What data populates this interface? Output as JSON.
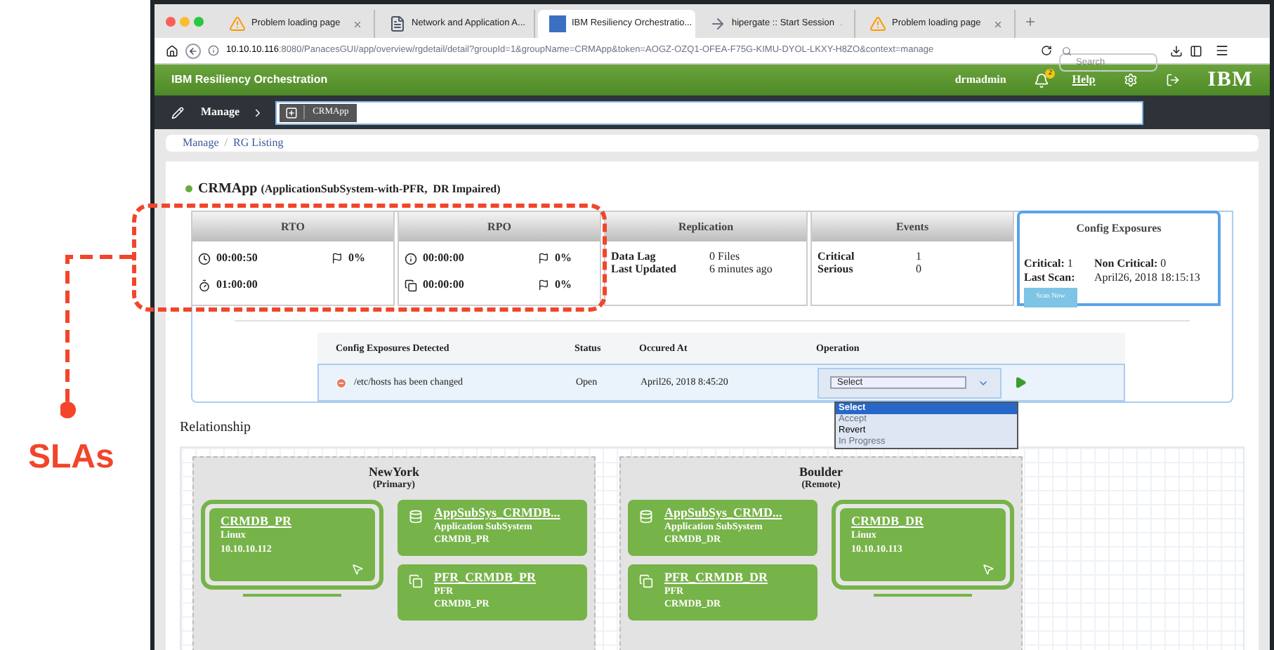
{
  "annotation": {
    "label": "SLAs"
  },
  "browser": {
    "tabs": [
      {
        "kind": "warning",
        "title": "Problem loading page",
        "selected": false
      },
      {
        "kind": "doc",
        "title": "Network and Application A...",
        "selected": false
      },
      {
        "kind": "app",
        "title": "IBM Resiliency Orchestratio...",
        "selected": true
      },
      {
        "kind": "arrow",
        "title": "hipergate :: Start Session",
        "selected": false
      },
      {
        "kind": "warning",
        "title": "Problem loading page",
        "selected": false
      }
    ],
    "url_host": "10.10.10.116",
    "url_rest": ":8080/PanacesGUI/app/overview/rgdetail/detail?groupId=1&groupName=CRMApp&token=AOGZ-OZQ1-OFEA-F75G-KIMU-DYOL-LKXY-H8ZO&context=manage",
    "search_placeholder": "Search"
  },
  "header": {
    "title": "IBM Resiliency Orchestration",
    "user": "drmadmin",
    "notifications": "2",
    "help": "Help",
    "logo": "IBM"
  },
  "manage_bar": {
    "label": "Manage",
    "chip": "CRMApp"
  },
  "breadcrumb": {
    "items": [
      "Manage",
      "RG Listing"
    ],
    "separator": "/"
  },
  "group": {
    "name": "CRMApp",
    "detail": "(ApplicationSubSystem-with-PFR,  DR Impaired)",
    "color": "#6aab3c"
  },
  "cards": [
    {
      "kind": "sla",
      "title": "RTO",
      "selected": false,
      "rows": [
        {
          "kind": "clock",
          "value": "00:00:50",
          "percent": "0%"
        },
        {
          "kind": "timer",
          "value": "01:00:00"
        }
      ]
    },
    {
      "kind": "sla",
      "title": "RPO",
      "selected": false,
      "rows": [
        {
          "kind": "info",
          "value": "00:00:00",
          "percent": "0%"
        },
        {
          "kind": "copy",
          "value": "00:00:00",
          "percent": "0%"
        }
      ]
    },
    {
      "kind": "pairs",
      "title": "Replication",
      "selected": false,
      "rows": [
        {
          "label": "Data Lag",
          "value": "0 Files"
        },
        {
          "label": "Last Updated",
          "value": "6 minutes ago"
        }
      ]
    },
    {
      "kind": "pairs",
      "title": "Events",
      "selected": false,
      "rows": [
        {
          "label": "Critical",
          "value": "1"
        },
        {
          "label": "Serious",
          "value": "0"
        }
      ]
    },
    {
      "kind": "config",
      "title": "Config Exposures",
      "selected": true,
      "critical_label": "Critical:",
      "critical": "1",
      "noncritical_label": "Non Critical:",
      "noncritical": "0",
      "scan_label": "Last Scan:",
      "scan": "April26, 2018 18:15:13",
      "button": "Scan Now"
    }
  ],
  "exposures": {
    "columns": [
      "Config Exposures Detected",
      "Status",
      "Occured At",
      "Operation"
    ],
    "rows": [
      {
        "text": "/etc/hosts has been changed",
        "status": "Open",
        "time": "April26, 2018 8:45:20",
        "operation": "Select"
      }
    ],
    "dropdown": [
      {
        "label": "Select",
        "selected": true,
        "disabled": false
      },
      {
        "label": "Accept",
        "selected": false,
        "disabled": true
      },
      {
        "label": "Revert",
        "selected": false,
        "disabled": false
      },
      {
        "label": "In Progress",
        "selected": false,
        "disabled": true
      }
    ]
  },
  "relationship": {
    "title": "Relationship",
    "sites": [
      {
        "name": "NewYork",
        "role": "(Primary)",
        "server": {
          "name": "CRMDB_PR",
          "os": "Linux",
          "ip": "10.10.10.112"
        },
        "services": [
          {
            "kind": "database",
            "name": "AppSubSys_CRMDB...",
            "type": "Application SubSystem",
            "host": "CRMDB_PR"
          },
          {
            "kind": "copy",
            "name": "PFR_CRMDB_PR",
            "type": "PFR",
            "host": "CRMDB_PR"
          }
        ]
      },
      {
        "name": "Boulder",
        "role": "(Remote)",
        "server": {
          "name": "CRMDB_DR",
          "os": "Linux",
          "ip": "10.10.10.113"
        },
        "services": [
          {
            "kind": "database",
            "name": "AppSubSys_CRMD...",
            "type": "Application SubSystem",
            "host": "CRMDB_DR"
          },
          {
            "kind": "copy",
            "name": "PFR_CRMDB_DR",
            "type": "PFR",
            "host": "CRMDB_DR"
          }
        ]
      }
    ]
  }
}
